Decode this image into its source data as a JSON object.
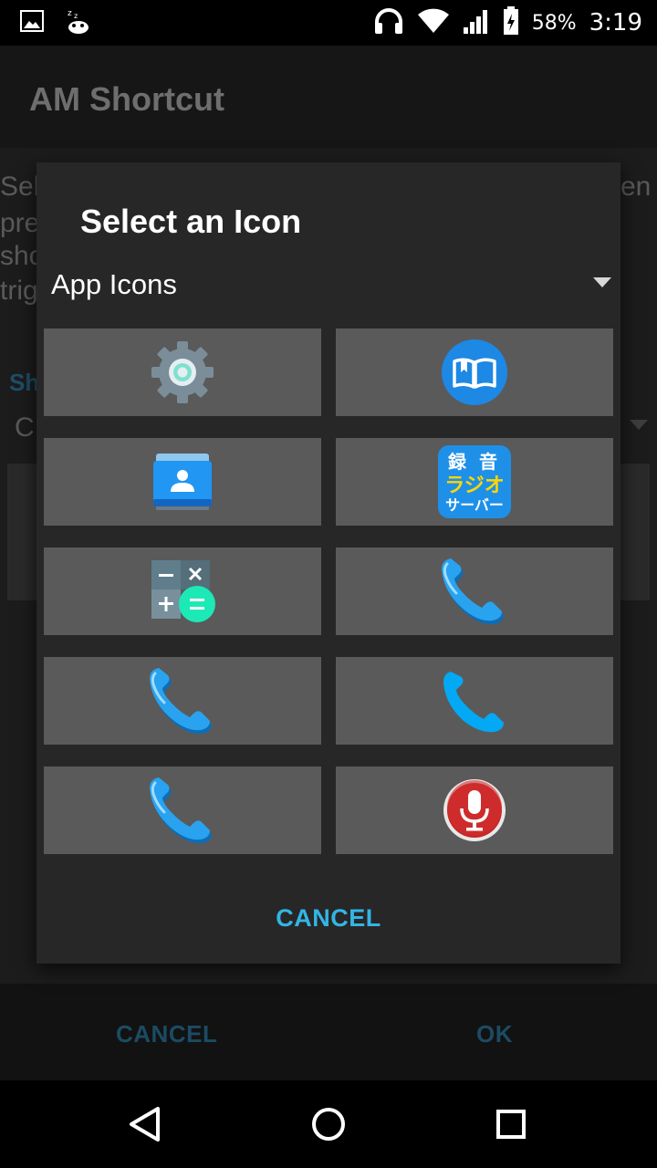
{
  "status_bar": {
    "battery_percent": "58%",
    "time": "3:19"
  },
  "app": {
    "title": "AM Shortcut",
    "bg_lines": [
      "Sel",
      "pre",
      "sho",
      "trig",
      "en"
    ],
    "bg_label": "Sh",
    "bg_value": "C",
    "cancel_label": "CANCEL",
    "ok_label": "OK"
  },
  "dialog": {
    "title": "Select an Icon",
    "spinner_value": "App Icons",
    "cancel_label": "CANCEL",
    "icons": [
      "settings-icon",
      "book-icon",
      "contacts-icon",
      "radio-recorder-icon",
      "calculator-icon",
      "phone-icon",
      "phone-icon",
      "phone-flat-icon",
      "phone-icon",
      "microphone-icon"
    ],
    "radio_icon_text": [
      "録",
      "音",
      "ラジオ",
      "サーバー"
    ]
  },
  "colors": {
    "accent": "#33b5e5",
    "tile": "#5a5a5a",
    "dialog_bg": "#272727"
  }
}
